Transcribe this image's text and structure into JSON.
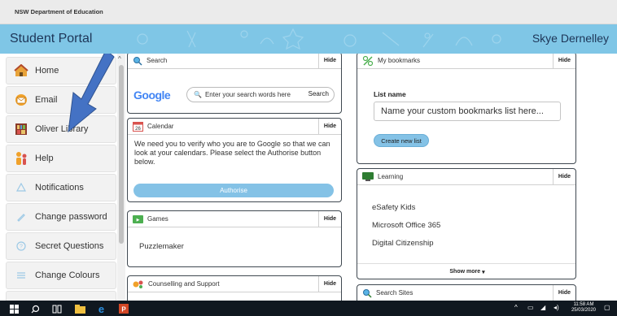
{
  "top_bar": {
    "department": "NSW Department of Education"
  },
  "header": {
    "portal_title": "Student Portal",
    "user_name": "Skye Dernelley"
  },
  "sidebar": {
    "items": [
      {
        "label": "Home",
        "icon": "home-icon"
      },
      {
        "label": "Email",
        "icon": "email-icon"
      },
      {
        "label": "Oliver Library",
        "icon": "library-icon"
      },
      {
        "label": "Help",
        "icon": "help-icon"
      },
      {
        "label": "Notifications",
        "icon": "bell-icon"
      },
      {
        "label": "Change password",
        "icon": "pencil-icon"
      },
      {
        "label": "Secret Questions",
        "icon": "question-icon"
      },
      {
        "label": "Change Colours",
        "icon": "list-icon"
      }
    ]
  },
  "cards": {
    "hide_label": "Hide",
    "search": {
      "title": "Search",
      "logo": "Google",
      "placeholder": "Enter your search words here",
      "button": "Search"
    },
    "calendar": {
      "title": "Calendar",
      "date_icon_text": "26",
      "message": "We need you to verify who you are to Google so that we can look at your calendars. Please select the Authorise button below.",
      "button": "Authorise"
    },
    "games": {
      "title": "Games",
      "items": [
        "Puzzlemaker"
      ]
    },
    "counselling": {
      "title": "Counselling and Support"
    },
    "bookmarks": {
      "title": "My bookmarks",
      "list_name_label": "List name",
      "input_placeholder": "Name your custom bookmarks list here...",
      "button": "Create new list"
    },
    "learning": {
      "title": "Learning",
      "items": [
        "eSafety Kids",
        "Microsoft Office 365",
        "Digital Citizenship"
      ],
      "show_more": "Show more"
    },
    "search_sites": {
      "title": "Search Sites"
    }
  },
  "taskbar": {
    "time": "11:58 AM",
    "date": "25/03/2020"
  },
  "colors": {
    "header_bg": "#7fc6e6",
    "button_blue": "#84c2e6",
    "arrow_blue": "#4472c4"
  }
}
